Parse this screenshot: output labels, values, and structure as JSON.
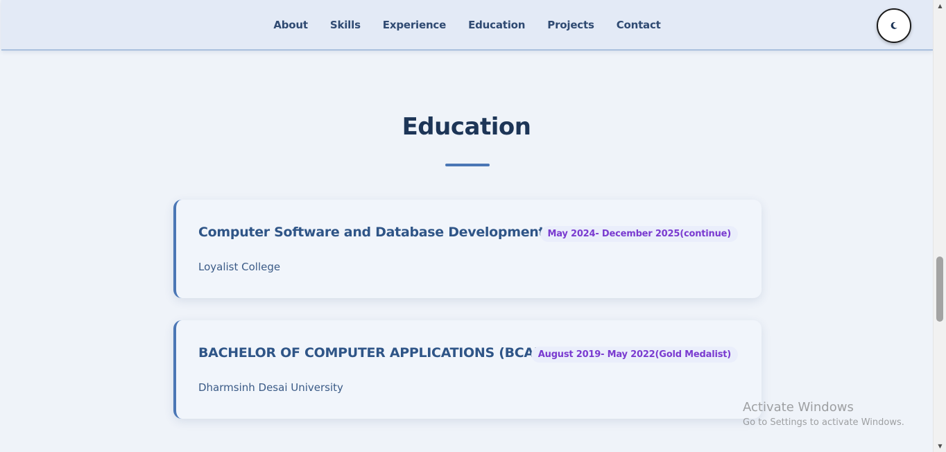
{
  "nav": {
    "links": [
      "About",
      "Skills",
      "Experience",
      "Education",
      "Projects",
      "Contact"
    ],
    "theme_toggle_icon": "moon-icon"
  },
  "education": {
    "title": "Education",
    "items": [
      {
        "degree": "Computer Software and Database Development",
        "dates": "May 2024- December 2025(continue)",
        "institution": "Loyalist College"
      },
      {
        "degree": "BACHELOR OF COMPUTER APPLICATIONS (BCA)",
        "dates": "August 2019- May 2022(Gold Medalist)",
        "institution": "Dharmsinh Desai University"
      }
    ]
  },
  "watermark": {
    "title": "Activate Windows",
    "subtitle": "Go to Settings to activate Windows."
  },
  "colors": {
    "accent": "#4a76b5",
    "heading": "#1d3557",
    "date_text": "#7a3bd0",
    "navbar_bg": "#e3eaf6",
    "page_bg": "#eff3f9"
  }
}
